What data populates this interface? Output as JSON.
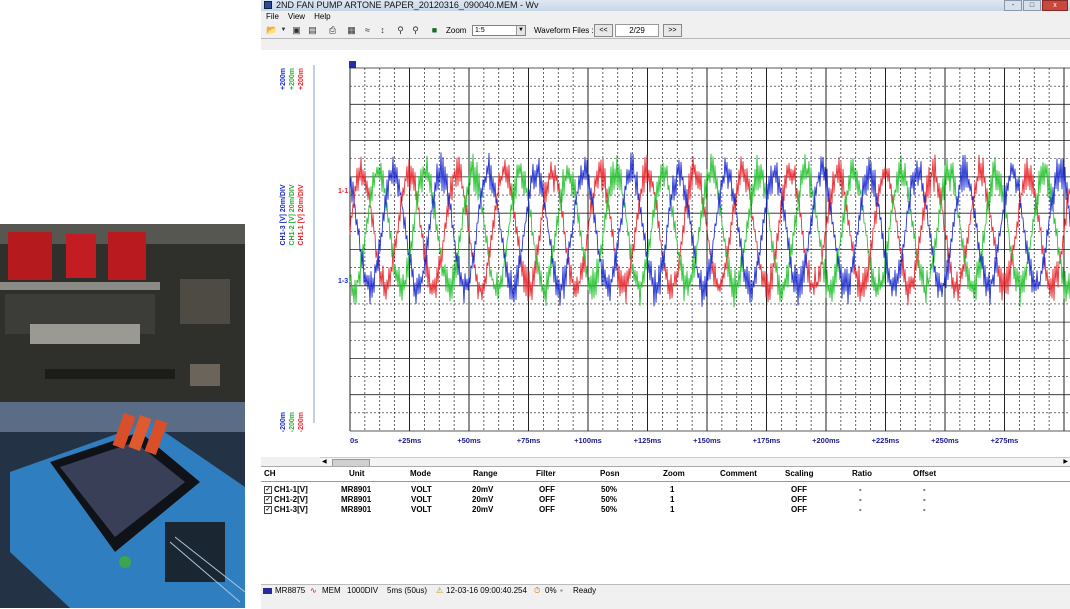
{
  "window": {
    "title": "2ND FAN PUMP ARTONE PAPER_20120316_090040.MEM - Wv",
    "buttons": [
      "-",
      "□",
      "x"
    ]
  },
  "menu": [
    "File",
    "View",
    "Help"
  ],
  "toolbar": {
    "icons": [
      "open-icon",
      "dropdown-icon",
      "save-icon",
      "save-as-icon",
      "print-icon",
      "settings-icon",
      "channel-icon",
      "cursor-icon",
      "zoom-in-icon",
      "zoom-out-icon",
      "export-icon"
    ],
    "zoom_label": "Zoom",
    "zoom_value": "1:5",
    "waveform_files_label": "Waveform Files :",
    "prev_label": "<<",
    "page": "2/29",
    "next_label": ">>"
  },
  "axis": {
    "top_labels": [
      "+200m",
      "+200m",
      "+200m"
    ],
    "bottom_labels": [
      "-200m",
      "-200m",
      "-200m"
    ],
    "channel_labels": [
      "CH1-3 [V] 20m/DIV",
      "CH1-2 [V] 20m/DIV",
      "CH1-1 [V] 20m/DIV"
    ],
    "marker_labels": [
      "1-1",
      "1-3"
    ],
    "x_ticks": [
      "0s",
      "+25ms",
      "+50ms",
      "+75ms",
      "+100ms",
      "+125ms",
      "+150ms",
      "+175ms",
      "+200ms",
      "+225ms",
      "+250ms",
      "+275ms"
    ]
  },
  "colors": {
    "ch1_1": "#e8242a",
    "ch1_2": "#22c22c",
    "ch1_3": "#1a2ad0",
    "grid": "#222222"
  },
  "table": {
    "headers": [
      "CH",
      "Unit",
      "Mode",
      "Range",
      "Filter",
      "Posn",
      "Zoom",
      "Comment",
      "Scaling",
      "Ratio",
      "Offset"
    ],
    "rows": [
      {
        "ch": "CH1-1[V]",
        "unit": "MR8901",
        "mode": "VOLT",
        "range": "20mV",
        "filter": "OFF",
        "posn": "50%",
        "zoom": "1",
        "comment": "",
        "scaling": "OFF",
        "ratio": "-",
        "offset": "-"
      },
      {
        "ch": "CH1-2[V]",
        "unit": "MR8901",
        "mode": "VOLT",
        "range": "20mV",
        "filter": "OFF",
        "posn": "50%",
        "zoom": "1",
        "comment": "",
        "scaling": "OFF",
        "ratio": "-",
        "offset": "-"
      },
      {
        "ch": "CH1-3[V]",
        "unit": "MR8901",
        "mode": "VOLT",
        "range": "20mV",
        "filter": "OFF",
        "posn": "50%",
        "zoom": "1",
        "comment": "",
        "scaling": "OFF",
        "ratio": "-",
        "offset": "-"
      }
    ]
  },
  "status": {
    "device": "MR8875",
    "mode": "MEM",
    "div": "1000DIV",
    "rate": "5ms (50us)",
    "timestamp": "12-03-16 09:00:40.254",
    "progress": "0%",
    "state": "Ready"
  }
}
